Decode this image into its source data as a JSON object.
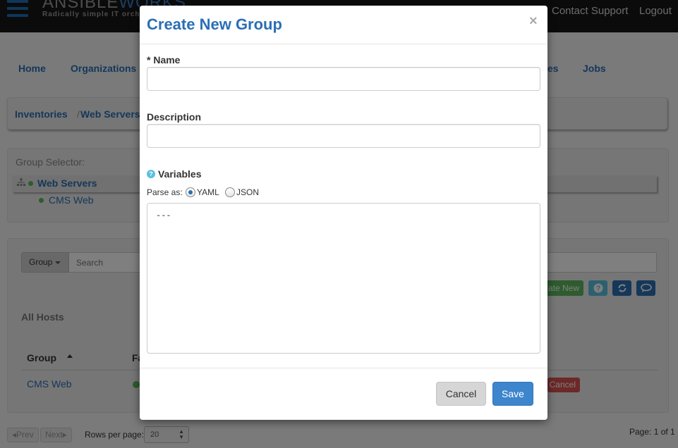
{
  "topbar": {
    "brand_main": "ANSIBLE",
    "brand_accent": "WORKS",
    "tagline": "Radically simple IT orch",
    "contact_support": "Contact Support",
    "logout": "Logout"
  },
  "nav": {
    "home": "Home",
    "organizations": "Organizations",
    "partial_tab": "es",
    "jobs": "Jobs"
  },
  "breadcrumb": {
    "inventories": "Inventories",
    "separator": "/",
    "web_servers": "Web Servers"
  },
  "group_selector": {
    "title": "Group Selector:",
    "tree": [
      {
        "label": "Web Servers"
      },
      {
        "label": "CMS Web"
      }
    ]
  },
  "hosts": {
    "group_button": "Group",
    "search_placeholder": "Search",
    "create_new_partial": "ate New",
    "section_title": "All Hosts",
    "columns": [
      "Group",
      "Fa"
    ],
    "rows": [
      {
        "group": "CMS Web",
        "action_partial": "Cancel"
      }
    ]
  },
  "pager": {
    "prev": "Prev",
    "next": "Next",
    "rows_label": "Rows per page:",
    "rows_value": "20",
    "page_info": "Page: 1 of 1"
  },
  "modal": {
    "title": "Create New Group",
    "close": "×",
    "name_label": "* Name",
    "name_value": "",
    "description_label": "Description",
    "description_value": "",
    "variables_label": "Variables",
    "parse_as_label": "Parse as:",
    "parse_options": [
      "YAML",
      "JSON"
    ],
    "parse_selected": "YAML",
    "variables_value": "---",
    "cancel": "Cancel",
    "save": "Save"
  },
  "colors": {
    "accent": "#2a6fb5",
    "save": "#3d85cc",
    "success": "#5cb85c",
    "danger": "#d9534f",
    "info": "#5bc0de"
  }
}
